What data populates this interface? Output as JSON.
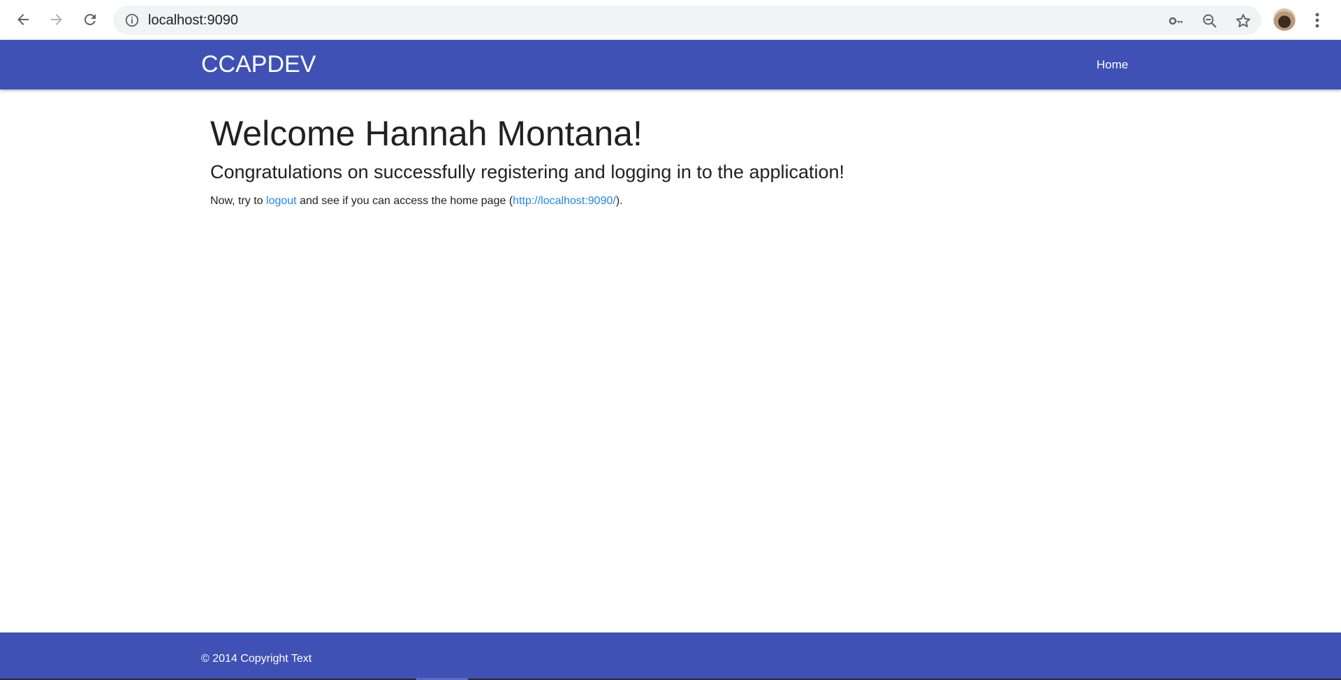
{
  "browser": {
    "url": "localhost:9090",
    "icons": {
      "back": "arrow-left-icon",
      "forward": "arrow-right-icon",
      "reload": "reload-icon",
      "info": "info-icon",
      "key": "key-icon",
      "zoom": "zoom-out-icon",
      "bookmark": "star-icon",
      "profile": "avatar",
      "menu": "kebab-menu-icon"
    }
  },
  "navbar": {
    "brand": "CCAPDEV",
    "links": [
      {
        "label": "Home"
      }
    ],
    "color": "#3f51b5"
  },
  "main": {
    "heading": "Welcome Hannah Montana!",
    "subheading": "Congratulations on successfully registering and logging in to the application!",
    "note": {
      "prefix": "Now, try to ",
      "logout_link": "logout",
      "middle": " and see if you can access the home page (",
      "home_link": "http://localhost:9090/",
      "suffix": ")."
    },
    "link_color": "#1e88e5"
  },
  "footer": {
    "text": "© 2014 Copyright Text",
    "color": "#3f51b5"
  }
}
